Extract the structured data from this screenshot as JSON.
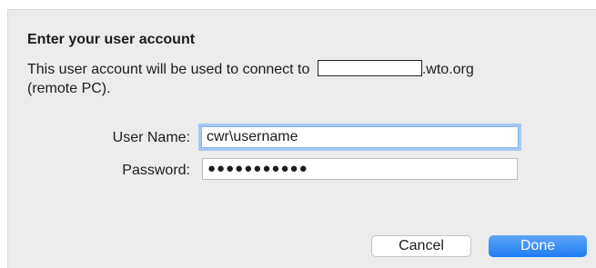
{
  "dialog": {
    "title": "Enter your user account",
    "message_line1_prefix": "This user account will be used to connect to ",
    "message_line1_suffix": ".wto.org",
    "message_line2": "(remote PC).",
    "username_label": "User Name:",
    "username_value": "cwr\\username",
    "password_label": "Password:",
    "password_mask": "●●●●●●●●●●●",
    "cancel_label": "Cancel",
    "done_label": "Done"
  },
  "colors": {
    "dialog_background": "#ececec",
    "focus_ring": "#a6c8ef",
    "primary_button": "#1f7cf3"
  }
}
